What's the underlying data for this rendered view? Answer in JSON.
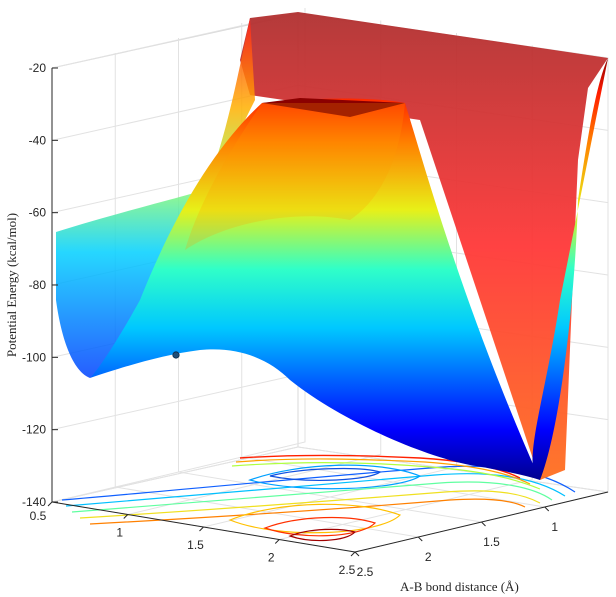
{
  "chart_data": {
    "type": "surface3d",
    "title": "",
    "zlabel": "Potential Energy (kcal/mol)",
    "xlabel": "A-B bond distance (Å)",
    "ylabel": "",
    "zlim": [
      -140,
      -20
    ],
    "x_range": [
      0.5,
      2.5
    ],
    "y_range": [
      0.5,
      2.5
    ],
    "z_ticks": [
      "-20",
      "-40",
      "-60",
      "-80",
      "-100",
      "-120",
      "-140"
    ],
    "left_axis_ticks": [
      "0.5",
      "1",
      "1.5",
      "2",
      "2.5"
    ],
    "right_axis_ticks": [
      "1",
      "1.5",
      "2",
      "2.5"
    ],
    "colormap": "jet",
    "grid": true,
    "contour_projection": true,
    "marker": {
      "x": 0.75,
      "y": 2.5,
      "z": -98,
      "color": "#1f4e79"
    },
    "features": {
      "plateau_energy": -30,
      "left_valley_min": -106,
      "saddle_energy": -98,
      "right_valley_min": -135
    }
  }
}
